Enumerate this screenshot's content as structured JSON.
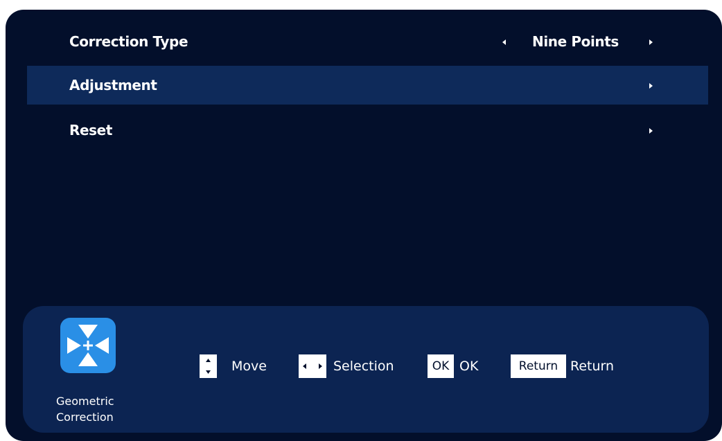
{
  "menu": {
    "items": [
      {
        "label": "Correction Type",
        "value": "Nine Points"
      },
      {
        "label": "Adjustment"
      },
      {
        "label": "Reset"
      }
    ]
  },
  "help": {
    "feature_icon": "geometric-correction-icon",
    "feature_label_line1": "Geometric",
    "feature_label_line2": "Correction",
    "hints": [
      {
        "key_icon": "up-down-key-icon",
        "label": "Move"
      },
      {
        "key_icon": "left-right-key-icon",
        "label": "Selection"
      },
      {
        "key": "OK",
        "label": "OK"
      },
      {
        "key": "Return",
        "label": "Return"
      }
    ]
  },
  "colors": {
    "background": "#030f2b",
    "selected_row": "#0e2a5a",
    "help_bar": "#0c2452",
    "icon_accent": "#2a8fe6"
  }
}
